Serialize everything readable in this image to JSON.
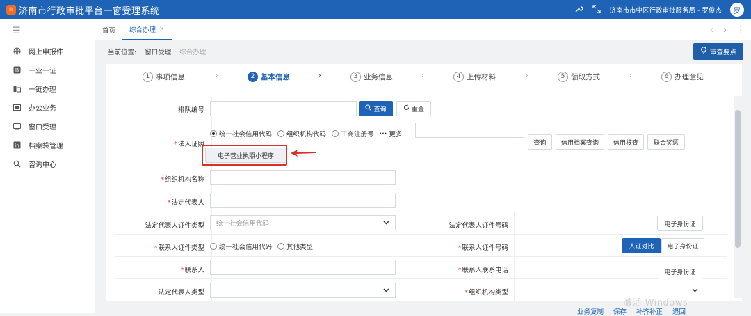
{
  "header": {
    "app_title": "济南市行政审批平台一窗受理系统",
    "logo_text": "ılı",
    "user_info": "济南市市中区行政审批服务局 - 罗俊杰",
    "avatar_text": "罗",
    "colors": {
      "brand": "#1e63b6",
      "logo": "#f36c21"
    }
  },
  "sidebar": {
    "toggle_icon": "menu-icon",
    "items": [
      {
        "label": "网上申报件",
        "icon": "globe-icon"
      },
      {
        "label": "一业一证",
        "icon": "badge-b-icon"
      },
      {
        "label": "一链办理",
        "icon": "chain-icon"
      },
      {
        "label": "办公业务",
        "icon": "office-icon"
      },
      {
        "label": "窗口受理",
        "icon": "window-icon"
      },
      {
        "label": "档案袋管理",
        "icon": "archive-icon"
      },
      {
        "label": "咨询中心",
        "icon": "search-icon"
      }
    ]
  },
  "tabs": [
    {
      "label": "首页",
      "active": false
    },
    {
      "label": "综合办理",
      "active": true,
      "close": "×"
    }
  ],
  "breadcrumb": {
    "prefix": "当前位置:",
    "items": [
      "窗口受理",
      "综合办理"
    ]
  },
  "review_button": "审查要点",
  "steps": [
    {
      "num": "1",
      "label": "事项信息"
    },
    {
      "num": "2",
      "label": "基本信息",
      "active": true
    },
    {
      "num": "3",
      "label": "业务信息"
    },
    {
      "num": "4",
      "label": "上传材料"
    },
    {
      "num": "5",
      "label": "领取方式"
    },
    {
      "num": "6",
      "label": "办理意见"
    }
  ],
  "form": {
    "queue_label": "排队编号",
    "query_btn": "查询",
    "reset_btn": "重置",
    "legal_cert_label": "法人证照",
    "cert_options": [
      "统一社会信用代码",
      "组织机构代码",
      "工商注册号"
    ],
    "more": "更多",
    "biz_license_btn": "电子营业执照小程序",
    "right_buttons": [
      "查询",
      "信用档案查询",
      "信用核查",
      "联合奖惩"
    ],
    "org_name_label": "组织机构名称",
    "legal_rep_label": "法定代表人",
    "legal_rep_id_type_label": "法定代表人证件类型",
    "legal_rep_id_type_value": "统一社会信用代码",
    "legal_rep_id_no_label": "法定代表人证件号码",
    "eid_btn": "电子身份证",
    "contact_id_type_label": "联系人证件类型",
    "contact_id_options": [
      "统一社会信用代码",
      "其他类型"
    ],
    "contact_id_no_label": "联系人证件号码",
    "face_compare_btn": "人证对比",
    "contact_label": "联系人",
    "contact_phone_label": "联系人联系电话",
    "legal_rep_type_label": "法定代表人类型",
    "org_type_label": "组织机构类型"
  },
  "footer_links": [
    "业务复制",
    "保存",
    "补齐补正",
    "退回"
  ],
  "watermark": "激活 Windows"
}
